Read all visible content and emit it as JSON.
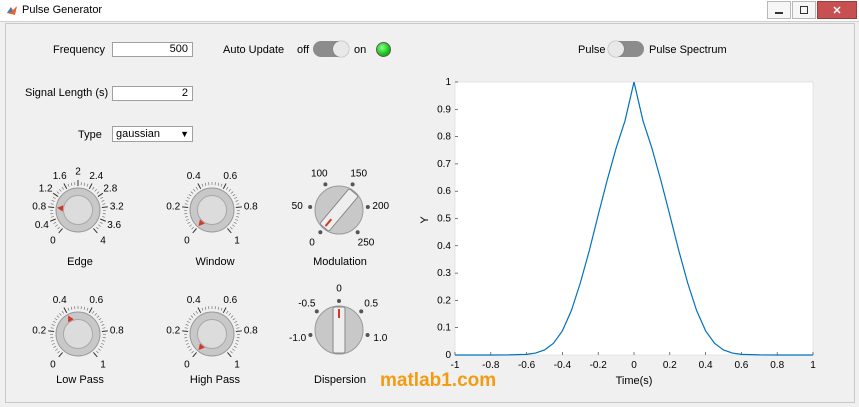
{
  "window": {
    "title": "Pulse Generator"
  },
  "controls": {
    "frequency": {
      "label": "Frequency",
      "value": "500"
    },
    "signal_length": {
      "label": "Signal Length (s)",
      "value": "2"
    },
    "type": {
      "label": "Type",
      "value": "gaussian"
    },
    "auto_update": {
      "label": "Auto Update",
      "off_label": "off",
      "on_label": "on",
      "state": "on"
    },
    "pulse_toggle": {
      "left_label": "Pulse",
      "right_label": "Pulse Spectrum",
      "state": "Pulse"
    }
  },
  "knobs": {
    "edge": {
      "name": "Edge",
      "ticks": [
        "0",
        "0.4",
        "0.8",
        "1.2",
        "1.6",
        "2",
        "2.4",
        "2.8",
        "3.2",
        "3.6",
        "4"
      ],
      "value": 0.8
    },
    "window": {
      "name": "Window",
      "ticks": [
        "0",
        "0.2",
        "0.4",
        "0.6",
        "0.8",
        "1"
      ],
      "value": 0
    },
    "modulation": {
      "name": "Modulation",
      "ticks": [
        "0",
        "50",
        "100",
        "150",
        "200",
        "250"
      ],
      "value": 0
    },
    "low_pass": {
      "name": "Low Pass",
      "ticks": [
        "0",
        "0.2",
        "0.4",
        "0.6",
        "0.8",
        "1"
      ],
      "value": 0.4
    },
    "high_pass": {
      "name": "High Pass",
      "ticks": [
        "0",
        "0.2",
        "0.4",
        "0.6",
        "0.8",
        "1"
      ],
      "value": 0
    },
    "dispersion": {
      "name": "Dispersion",
      "ticks": [
        "-1.0",
        "-0.5",
        "0",
        "0.5",
        "1.0"
      ],
      "value": 0
    }
  },
  "chart_data": {
    "type": "line",
    "xlabel": "Time(s)",
    "ylabel": "Y",
    "xlim": [
      -1,
      1
    ],
    "ylim": [
      0,
      1
    ],
    "xticks": [
      "-1",
      "-0.8",
      "-0.6",
      "-0.4",
      "-0.2",
      "0",
      "0.2",
      "0.4",
      "0.6",
      "0.8",
      "1"
    ],
    "yticks": [
      "0",
      "0.1",
      "0.2",
      "0.3",
      "0.4",
      "0.5",
      "0.6",
      "0.7",
      "0.8",
      "0.9",
      "1"
    ],
    "grid": false,
    "series": [
      {
        "color": "#0072bd",
        "x": [
          -1,
          -0.9,
          -0.8,
          -0.7,
          -0.6,
          -0.55,
          -0.5,
          -0.45,
          -0.4,
          -0.35,
          -0.3,
          -0.25,
          -0.2,
          -0.15,
          -0.1,
          -0.05,
          0,
          0.05,
          0.1,
          0.15,
          0.2,
          0.25,
          0.3,
          0.35,
          0.4,
          0.45,
          0.5,
          0.55,
          0.6,
          0.7,
          0.8,
          0.9,
          1
        ],
        "y": [
          0,
          0,
          0,
          0.0002,
          0.0023,
          0.007,
          0.0183,
          0.043,
          0.0885,
          0.163,
          0.2636,
          0.3824,
          0.5129,
          0.6405,
          0.7575,
          0.8578,
          1,
          0.8578,
          0.7575,
          0.6405,
          0.5129,
          0.3824,
          0.2636,
          0.163,
          0.0885,
          0.043,
          0.0183,
          0.007,
          0.0023,
          0.0002,
          0,
          0,
          0
        ]
      }
    ]
  },
  "watermark": "matlab1.com",
  "colors": {
    "curve": "#0072bd",
    "lamp_on": "#1ec81e",
    "knob_pointer": "#d0392b"
  }
}
